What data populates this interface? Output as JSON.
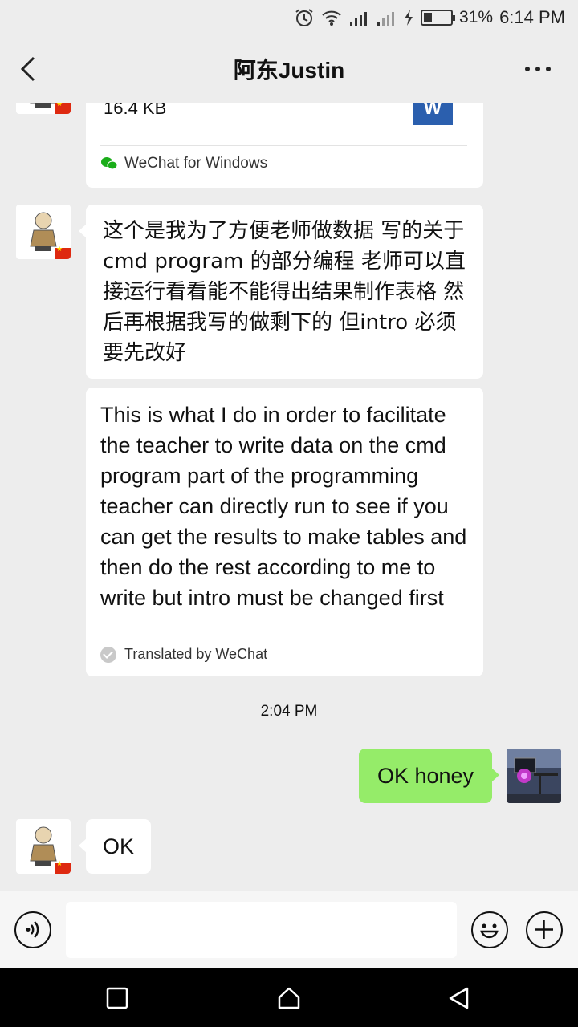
{
  "status_bar": {
    "battery_percent": "31%",
    "battery_level": 0.31,
    "time": "6:14 PM",
    "icons": [
      "alarm-icon",
      "wifi-icon",
      "signal-icon",
      "signal-icon",
      "charging-icon",
      "battery-icon"
    ]
  },
  "header": {
    "title": "阿东Justin",
    "back_icon": "chevron-left-icon",
    "more_icon": "more-dots-icon"
  },
  "messages": {
    "file_card": {
      "size": "16.4 KB",
      "file_type_letter": "W",
      "source": "WeChat for Windows",
      "accent": "#2b5fae"
    },
    "chinese_text": "这个是我为了方便老师做数据 写的关于cmd program 的部分编程 老师可以直接运行看看能不能得出结果制作表格 然后再根据我写的做剩下的 但intro 必须要先改好",
    "translation_text": "This is what I do in order to facilitate the teacher to write data on the cmd program part of the programming teacher can directly run to see if you can get the results to make tables and then do the rest according to me to write but intro must be changed first",
    "translated_by": "Translated by WeChat",
    "timestamp": "2:04 PM",
    "outgoing_text": "OK honey",
    "outgoing_color": "#95ec69",
    "reply_text": "OK"
  },
  "input_bar": {
    "placeholder": "",
    "voice_icon": "voice-icon",
    "emoji_icon": "emoji-icon",
    "plus_icon": "plus-icon"
  },
  "nav_bar": {
    "icons": [
      "recent-apps-icon",
      "home-icon",
      "back-triangle-icon"
    ]
  }
}
